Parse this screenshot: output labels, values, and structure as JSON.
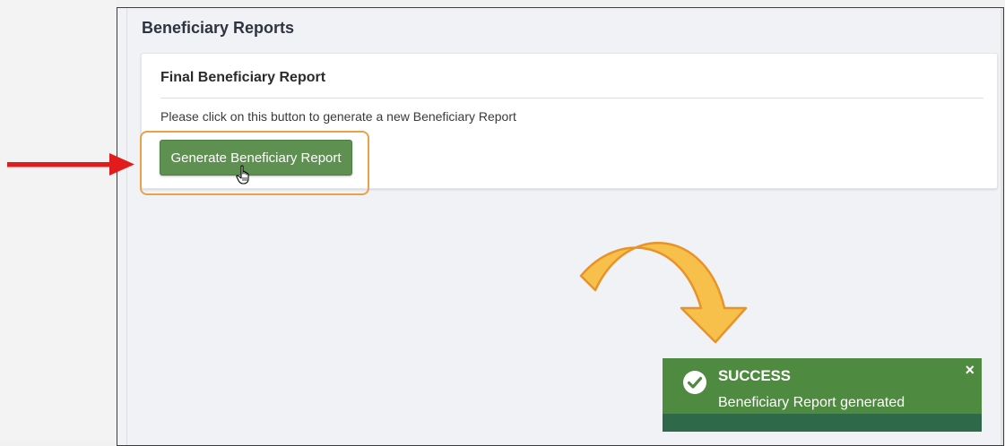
{
  "page": {
    "title": "Beneficiary Reports"
  },
  "card": {
    "title": "Final Beneficiary Report",
    "description": "Please click on this button to generate a new Beneficiary Report",
    "button_label": "Generate Beneficiary Report"
  },
  "toast": {
    "title": "SUCCESS",
    "message": "Beneficiary Report generated",
    "close_symbol": "×",
    "icon": "check-circle-icon"
  },
  "annotations": {
    "red_arrow_icon": "arrow-right-icon",
    "curved_arrow_icon": "curved-arrow-icon",
    "highlight_color": "#e8a24a",
    "red_arrow_color": "#e21c1c",
    "curved_arrow_color": "#f7c04a"
  },
  "colors": {
    "button": "#5e9151",
    "toast_bg": "#4e8a3f",
    "toast_bar": "#2e6a4a",
    "page_bg": "#f0f2f5"
  }
}
